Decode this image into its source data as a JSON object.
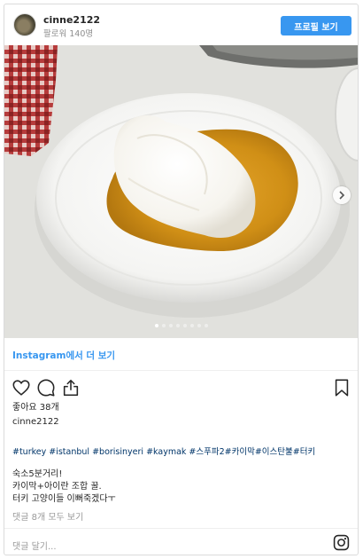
{
  "header": {
    "username": "cinne2122",
    "followers": "팔로워 140명",
    "profile_button": "프로필 보기"
  },
  "photo": {
    "slide_count": 8,
    "active_slide": 1,
    "next_icon": "chevron-right-icon"
  },
  "more_link": "Instagram에서 더 보기",
  "actions": {
    "like_icon": "heart-icon",
    "comment_icon": "comment-icon",
    "share_icon": "share-icon",
    "save_icon": "bookmark-icon"
  },
  "likes": "좋아요 38개",
  "post_author": "cinne2122",
  "hashtags": "#turkey #istanbul #borisinyeri #kaymak #스푸파2#카이막#이스탄불#터키",
  "caption_lines": [
    "숙소5분거리!",
    "카이막+아이란 조합 꿀.",
    "터키 고양이들 이뻐죽겠다ㅜ"
  ],
  "comments_link": "댓글 8개 모두 보기",
  "comment_placeholder": "댓글 달기...",
  "colors": {
    "accent": "#3897f0",
    "hashtag": "#003569",
    "muted": "#999999"
  }
}
